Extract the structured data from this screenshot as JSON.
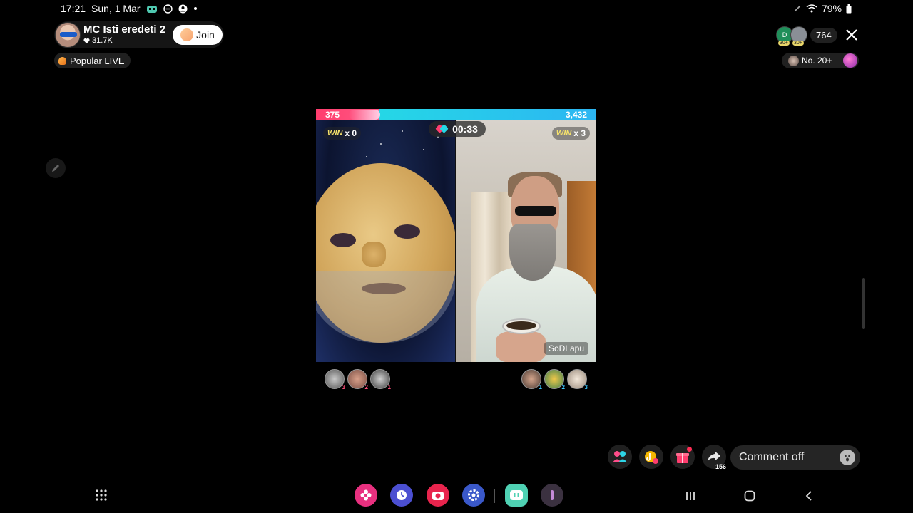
{
  "status_bar": {
    "time": "17:21",
    "date": "Sun, 1 Mar",
    "battery": "79%",
    "icons_left": [
      "app-notification-icon",
      "dnd-icon",
      "account-icon",
      "dot-icon"
    ],
    "icons_right": [
      "pen-icon",
      "wifi-icon",
      "battery-icon"
    ]
  },
  "host": {
    "name": "MC Isti eredeti 2",
    "likes": "31.7K",
    "join_label": "Join"
  },
  "popular": {
    "label": "Popular LIVE"
  },
  "viewers": {
    "count": "764",
    "avatar1_letter": "D",
    "avatar1_badge": "30+",
    "avatar2_badge": "30+"
  },
  "rank": {
    "label": "No. 20+"
  },
  "battle": {
    "score_left": "375",
    "score_right": "3,432",
    "score_left_fraction": 0.098,
    "timer": "00:33",
    "win_word": "WIN",
    "win_left": "x 0",
    "win_right": "x 3",
    "guest_name": "SoDI apu",
    "gifters_left_ranks": [
      "3",
      "2",
      "1"
    ],
    "gifters_right_ranks": [
      "1",
      "2",
      "3"
    ]
  },
  "actions": {
    "share_count": "156",
    "comment_placeholder": "Comment off"
  },
  "colors": {
    "score_left": "#ff3d6e",
    "score_right": "#25d7e6",
    "win_text": "#f7e36b"
  },
  "dock": {
    "apps": [
      "blossom-app-icon",
      "clock-app-icon",
      "camera-app-icon",
      "settings-app-icon",
      "tiktok-live-app-icon",
      "recent-app-icon"
    ]
  }
}
